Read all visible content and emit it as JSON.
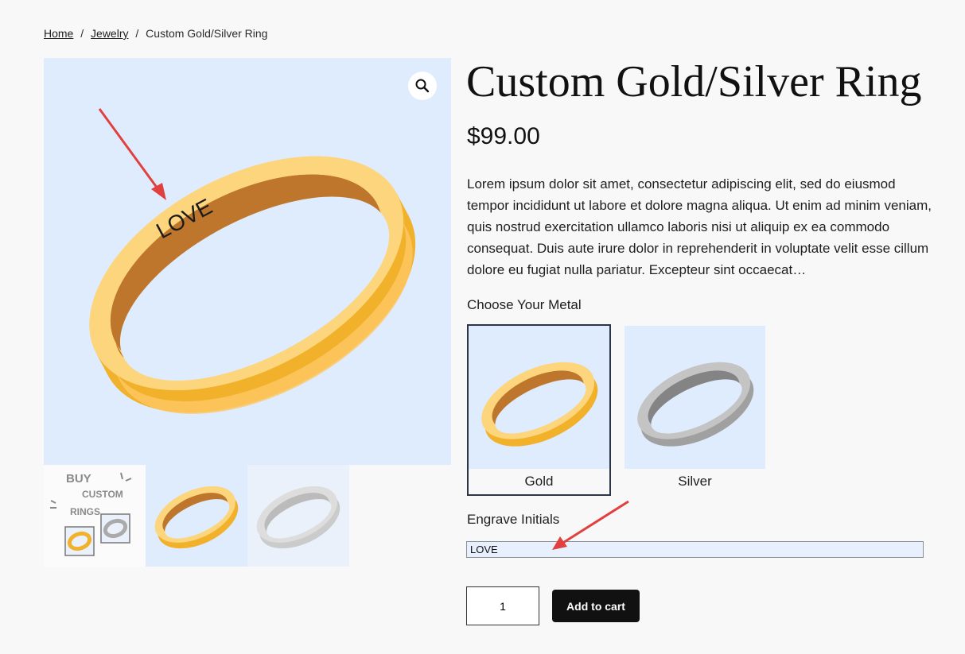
{
  "breadcrumb": {
    "home": "Home",
    "category": "Jewelry",
    "separator": "/",
    "current": "Custom Gold/Silver Ring"
  },
  "gallery": {
    "main_engraving": "LOVE",
    "thumb1_lines": [
      "BUY",
      "CUSTOM",
      "RINGS"
    ]
  },
  "product": {
    "title": "Custom Gold/Silver Ring",
    "price": "$99.00",
    "description": "Lorem ipsum dolor sit amet, consectetur adipiscing elit, sed do eiusmod tempor incididunt ut labore et dolore magna aliqua. Ut enim ad minim veniam, quis nostrud exercitation ullamco laboris nisi ut aliquip ex ea commodo consequat. Duis aute irure dolor in reprehenderit in voluptate velit esse cillum dolore eu fugiat nulla pariatur. Excepteur sint occaecat…"
  },
  "metal": {
    "label": "Choose Your Metal",
    "options": [
      "Gold",
      "Silver"
    ],
    "selected": "Gold"
  },
  "engrave": {
    "label": "Engrave Initials",
    "value": "LOVE"
  },
  "cart": {
    "quantity": "1",
    "add_label": "Add to cart"
  },
  "colors": {
    "gold": "#f2b12a",
    "gold_light": "#fcd57c",
    "gold_inner": "#bd762b",
    "silver": "#b8b8b8",
    "silver_inner": "#8a8a8a",
    "annotation_arrow": "#e0413f",
    "image_bg": "#dfecfd"
  }
}
